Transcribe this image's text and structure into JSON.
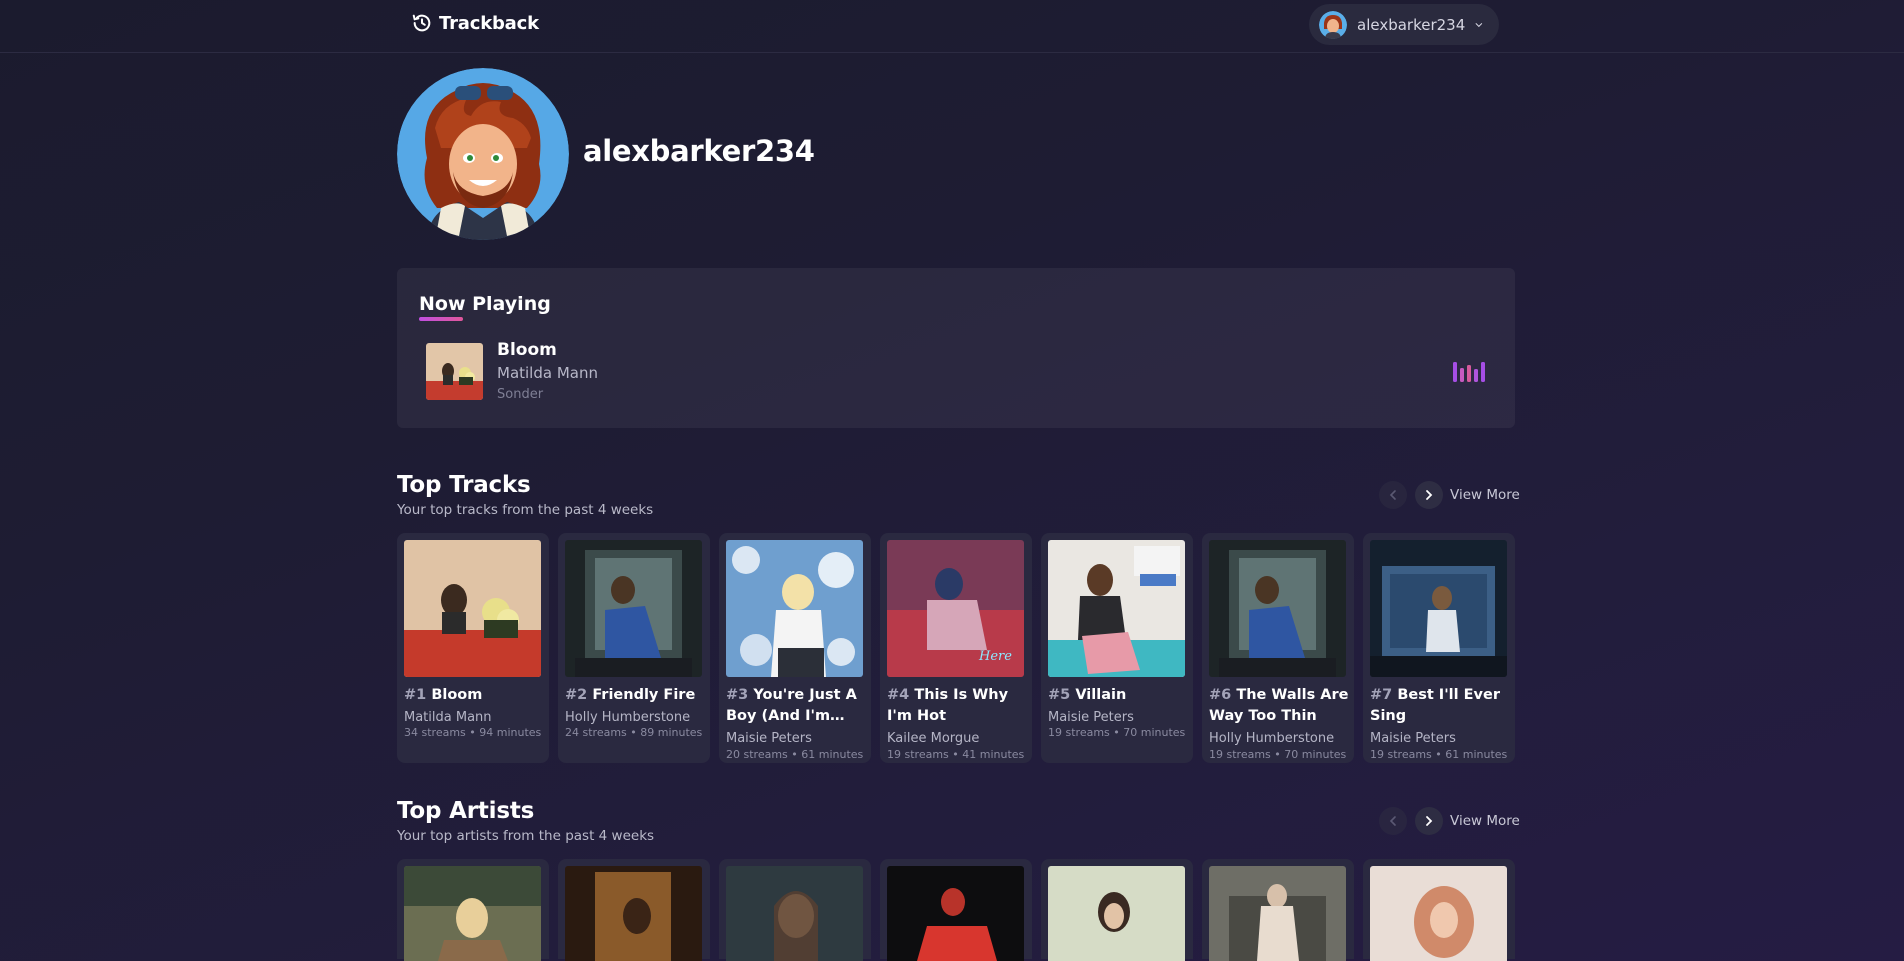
{
  "app": {
    "name": "Trackback"
  },
  "user": {
    "username": "alexbarker234"
  },
  "profile": {
    "display_name": "alexbarker234"
  },
  "now_playing": {
    "heading": "Now Playing",
    "track": "Bloom",
    "artist": "Matilda Mann",
    "album": "Sonder",
    "accent": "#c04fe0"
  },
  "top_tracks": {
    "title": "Top Tracks",
    "subtitle": "Your top tracks from the past 4 weeks",
    "view_more": "View More",
    "items": [
      {
        "rank": "#1",
        "title": "Bloom",
        "artist": "Matilda Mann",
        "meta": "34 streams • 94 minutes"
      },
      {
        "rank": "#2",
        "title": "Friendly Fire",
        "artist": "Holly Humberstone",
        "meta": "24 streams • 89 minutes"
      },
      {
        "rank": "#3",
        "title": "You're Just A Boy (And I'm…",
        "artist": "Maisie Peters",
        "meta": "20 streams • 61 minutes"
      },
      {
        "rank": "#4",
        "title": "This Is Why I'm Hot",
        "artist": "Kailee Morgue",
        "meta": "19 streams • 41 minutes"
      },
      {
        "rank": "#5",
        "title": "Villain",
        "artist": "Maisie Peters",
        "meta": "19 streams • 70 minutes"
      },
      {
        "rank": "#6",
        "title": "The Walls Are Way Too Thin",
        "artist": "Holly Humberstone",
        "meta": "19 streams • 70 minutes"
      },
      {
        "rank": "#7",
        "title": "Best I'll Ever Sing",
        "artist": "Maisie Peters",
        "meta": "19 streams • 61 minutes"
      }
    ]
  },
  "top_artists": {
    "title": "Top Artists",
    "subtitle": "Your top artists from the past 4 weeks",
    "view_more": "View More"
  }
}
